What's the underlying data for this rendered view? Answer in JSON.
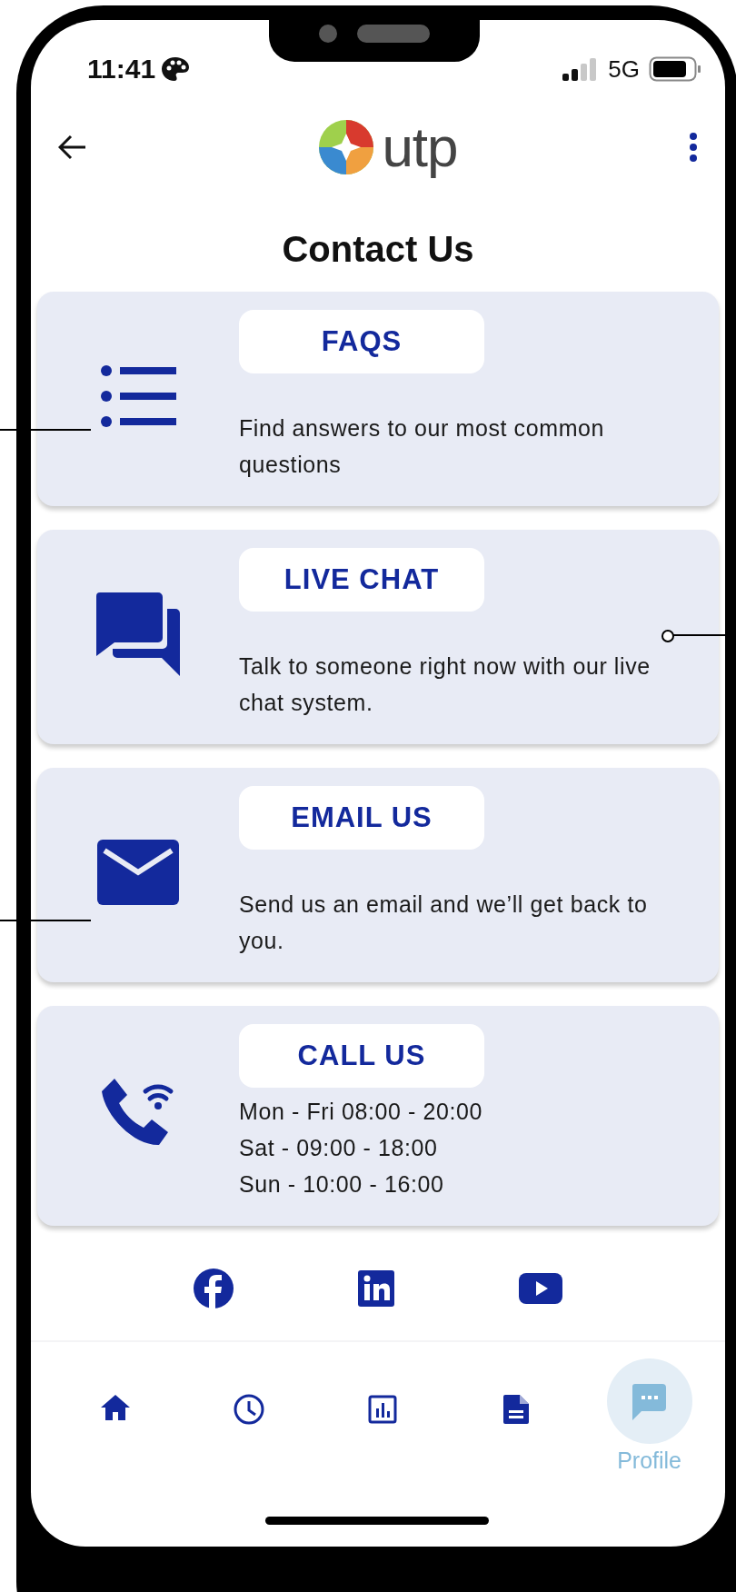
{
  "status_bar": {
    "time": "11:41",
    "network": "5G"
  },
  "header": {
    "logo_text": "utp"
  },
  "title": "Contact Us",
  "cards": [
    {
      "kind": "list",
      "title": "FAQS",
      "lines": [
        "Find answers to our most common questions"
      ]
    },
    {
      "kind": "chat",
      "title": "LIVE CHAT",
      "lines": [
        "Talk to someone right now with our live chat system."
      ]
    },
    {
      "kind": "email",
      "title": "EMAIL US",
      "lines": [
        "Send us an email and we’ll get back to you."
      ]
    },
    {
      "kind": "phone",
      "title": "CALL US",
      "lines": [
        "Mon - Fri 08:00 - 20:00",
        "Sat - 09:00 - 18:00",
        "Sun - 10:00 - 16:00"
      ]
    }
  ],
  "social": [
    {
      "kind": "facebook"
    },
    {
      "kind": "linkedin"
    },
    {
      "kind": "youtube"
    }
  ],
  "nav": [
    {
      "kind": "home",
      "selected": false
    },
    {
      "kind": "clock",
      "selected": false
    },
    {
      "kind": "chart",
      "selected": false
    },
    {
      "kind": "document",
      "selected": false
    },
    {
      "kind": "message",
      "selected": true,
      "label": "Profile"
    }
  ]
}
